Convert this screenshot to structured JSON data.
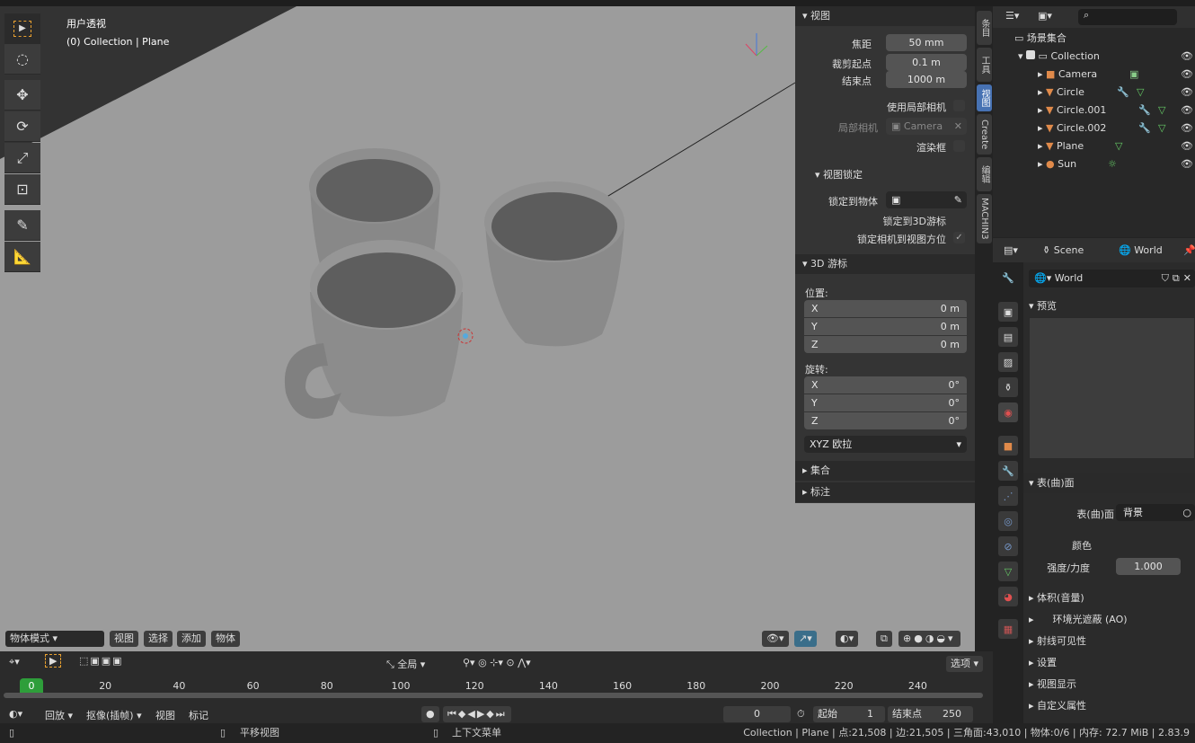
{
  "viewport": {
    "title": "用户透视",
    "subtitle": "(0) Collection | Plane",
    "header": {
      "mode": "物体模式",
      "menus": [
        "视图",
        "选择",
        "添加",
        "物体"
      ]
    }
  },
  "npanel": {
    "view_section": "视图",
    "focal_label": "焦距",
    "focal": "50 mm",
    "clip_start_label": "裁剪起点",
    "clip_start": "0.1 m",
    "clip_end_label": "结束点",
    "clip_end": "1000 m",
    "local_camera_toggle": "使用局部相机",
    "local_camera_label": "局部相机",
    "local_camera": "Camera",
    "render_region": "渲染框",
    "lock_section": "视图锁定",
    "lock_object": "锁定到物体",
    "lock_cursor": "锁定到3D游标",
    "lock_camera": "锁定相机到视图方位",
    "cursor_section": "3D 游标",
    "location": "位置:",
    "loc": [
      {
        "axis": "X",
        "value": "0 m"
      },
      {
        "axis": "Y",
        "value": "0 m"
      },
      {
        "axis": "Z",
        "value": "0 m"
      }
    ],
    "rotation": "旋转:",
    "rot": [
      {
        "axis": "X",
        "value": "0°"
      },
      {
        "axis": "Y",
        "value": "0°"
      },
      {
        "axis": "Z",
        "value": "0°"
      }
    ],
    "rotation_mode": "XYZ 欧拉",
    "collections": "集合",
    "annotations": "标注",
    "tabs": [
      "条目",
      "工具",
      "视图",
      "Create",
      "编辑",
      "MACHIN3"
    ]
  },
  "outliner": {
    "root": "场景集合",
    "items": [
      {
        "name": "Collection",
        "icon": "collection-icon"
      },
      {
        "name": "Camera",
        "icon": "camera-icon"
      },
      {
        "name": "Circle",
        "icon": "mesh-icon"
      },
      {
        "name": "Circle.001",
        "icon": "mesh-icon"
      },
      {
        "name": "Circle.002",
        "icon": "mesh-icon"
      },
      {
        "name": "Plane",
        "icon": "mesh-icon"
      },
      {
        "name": "Sun",
        "icon": "light-icon"
      }
    ]
  },
  "properties": {
    "scene": "Scene",
    "world": "World",
    "world_name": "World",
    "preview": "预览",
    "surface_section": "表(曲)面",
    "surface_label": "表(曲)面",
    "surface_value": "背景",
    "color_label": "颜色",
    "strength_label": "强度/力度",
    "strength": "1.000",
    "collapsed": [
      "体积(音量)",
      "环境光遮蔽 (AO)",
      "射线可见性",
      "设置",
      "视图显示",
      "自定义属性"
    ]
  },
  "timeline": {
    "menus": [
      "回放",
      "抠像(插帧)",
      "视图",
      "标记"
    ],
    "range": "全局",
    "options": "选项",
    "ticks": [
      "0",
      "20",
      "40",
      "60",
      "80",
      "100",
      "120",
      "140",
      "160",
      "180",
      "200",
      "220",
      "240"
    ],
    "current_frame": "0",
    "start_label": "起始",
    "start": "1",
    "end_label": "结束点",
    "end": "250"
  },
  "statusbar": {
    "pan": "平移视图",
    "context": "上下文菜单",
    "stats": "Collection | Plane | 点:21,508 | 边:21,505 | 三角面:43,010 | 物体:0/6 | 内存: 72.7 MiB | 2.83.9"
  },
  "colors": {
    "accent": "#4772b3",
    "frame": "#2e9e3a",
    "object": "#e08a4a"
  }
}
